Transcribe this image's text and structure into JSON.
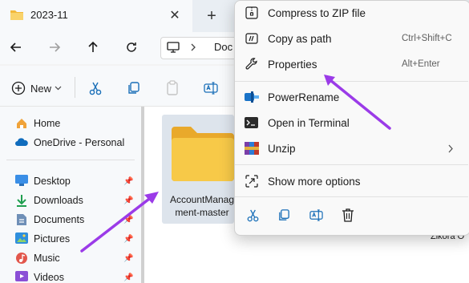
{
  "tab": {
    "title": "2023-11",
    "close_glyph": "✕",
    "new_tab_glyph": "+"
  },
  "address": {
    "text": "Doc"
  },
  "commandbar": {
    "new_label": "New"
  },
  "sidebar": {
    "items": [
      {
        "label": "Home",
        "icon": "home-icon"
      },
      {
        "label": "OneDrive - Personal",
        "icon": "onedrive-icon"
      },
      {
        "label": "Desktop",
        "icon": "desktop-icon",
        "pinned": true
      },
      {
        "label": "Downloads",
        "icon": "download-icon",
        "pinned": true
      },
      {
        "label": "Documents",
        "icon": "documents-icon",
        "pinned": true
      },
      {
        "label": "Pictures",
        "icon": "pictures-icon",
        "pinned": true
      },
      {
        "label": "Music",
        "icon": "music-icon",
        "pinned": true
      },
      {
        "label": "Videos",
        "icon": "videos-icon",
        "pinned": true
      }
    ],
    "pin_glyph": "📌"
  },
  "content": {
    "folder_name": "AccountManagement-master",
    "folder_name_visible": "AccountManag ment-master",
    "partial_text": "Zikora O"
  },
  "menu": {
    "items": [
      {
        "label": "Compress to ZIP file",
        "icon": "zip-icon",
        "shortcut": ""
      },
      {
        "label": "Copy as path",
        "icon": "copy-path-icon",
        "shortcut": "Ctrl+Shift+C"
      },
      {
        "label": "Properties",
        "icon": "wrench-icon",
        "shortcut": "Alt+Enter"
      },
      {
        "label": "PowerRename",
        "icon": "powerrename-icon",
        "shortcut": ""
      },
      {
        "label": "Open in Terminal",
        "icon": "terminal-icon",
        "shortcut": ""
      },
      {
        "label": "Unzip",
        "icon": "winrar-icon",
        "shortcut": "",
        "submenu": true
      },
      {
        "label": "Show more options",
        "icon": "show-more-icon",
        "shortcut": ""
      }
    ],
    "bottom_actions": [
      "cut-icon",
      "copy-icon",
      "rename-icon",
      "delete-icon"
    ]
  },
  "colors": {
    "accent": "#9b3be8",
    "folder": "#f7c948",
    "selection": "#dde4ec"
  }
}
